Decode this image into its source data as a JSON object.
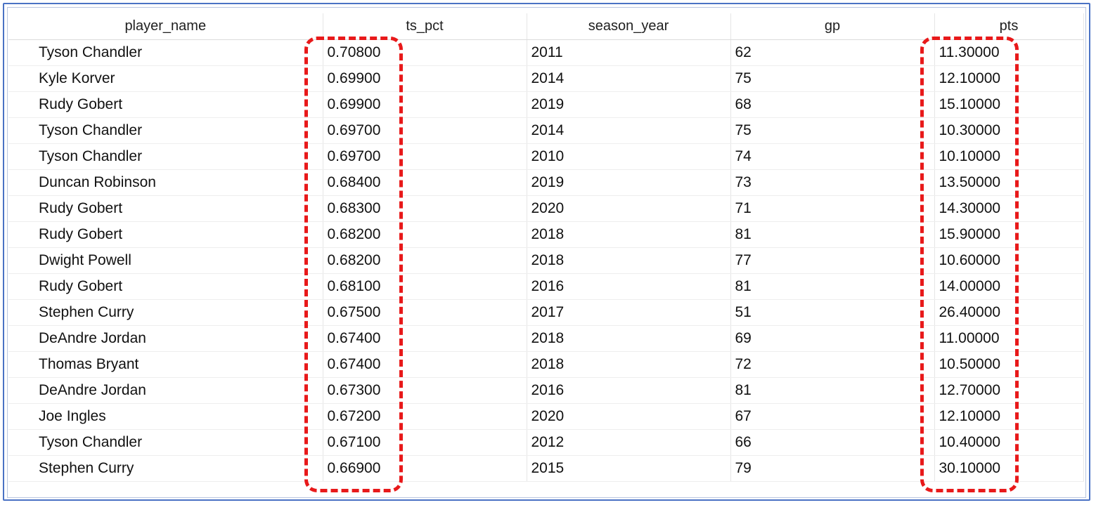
{
  "table": {
    "columns": [
      "player_name",
      "ts_pct",
      "season_year",
      "gp",
      "pts"
    ],
    "rows": [
      [
        "Tyson Chandler",
        "0.70800",
        "2011",
        "62",
        "11.30000"
      ],
      [
        "Kyle Korver",
        "0.69900",
        "2014",
        "75",
        "12.10000"
      ],
      [
        "Rudy Gobert",
        "0.69900",
        "2019",
        "68",
        "15.10000"
      ],
      [
        "Tyson Chandler",
        "0.69700",
        "2014",
        "75",
        "10.30000"
      ],
      [
        "Tyson Chandler",
        "0.69700",
        "2010",
        "74",
        "10.10000"
      ],
      [
        "Duncan Robinson",
        "0.68400",
        "2019",
        "73",
        "13.50000"
      ],
      [
        "Rudy Gobert",
        "0.68300",
        "2020",
        "71",
        "14.30000"
      ],
      [
        "Rudy Gobert",
        "0.68200",
        "2018",
        "81",
        "15.90000"
      ],
      [
        "Dwight Powell",
        "0.68200",
        "2018",
        "77",
        "10.60000"
      ],
      [
        "Rudy Gobert",
        "0.68100",
        "2016",
        "81",
        "14.00000"
      ],
      [
        "Stephen Curry",
        "0.67500",
        "2017",
        "51",
        "26.40000"
      ],
      [
        "DeAndre Jordan",
        "0.67400",
        "2018",
        "69",
        "11.00000"
      ],
      [
        "Thomas Bryant",
        "0.67400",
        "2018",
        "72",
        "10.50000"
      ],
      [
        "DeAndre Jordan",
        "0.67300",
        "2016",
        "81",
        "12.70000"
      ],
      [
        "Joe Ingles",
        "0.67200",
        "2020",
        "67",
        "12.10000"
      ],
      [
        "Tyson Chandler",
        "0.67100",
        "2012",
        "66",
        "10.40000"
      ],
      [
        "Stephen Curry",
        "0.66900",
        "2015",
        "79",
        "30.10000"
      ]
    ]
  },
  "highlighted_columns": [
    "ts_pct",
    "pts"
  ],
  "colors": {
    "frame_border": "#4a72c4",
    "highlight_dash": "#e8191a"
  }
}
